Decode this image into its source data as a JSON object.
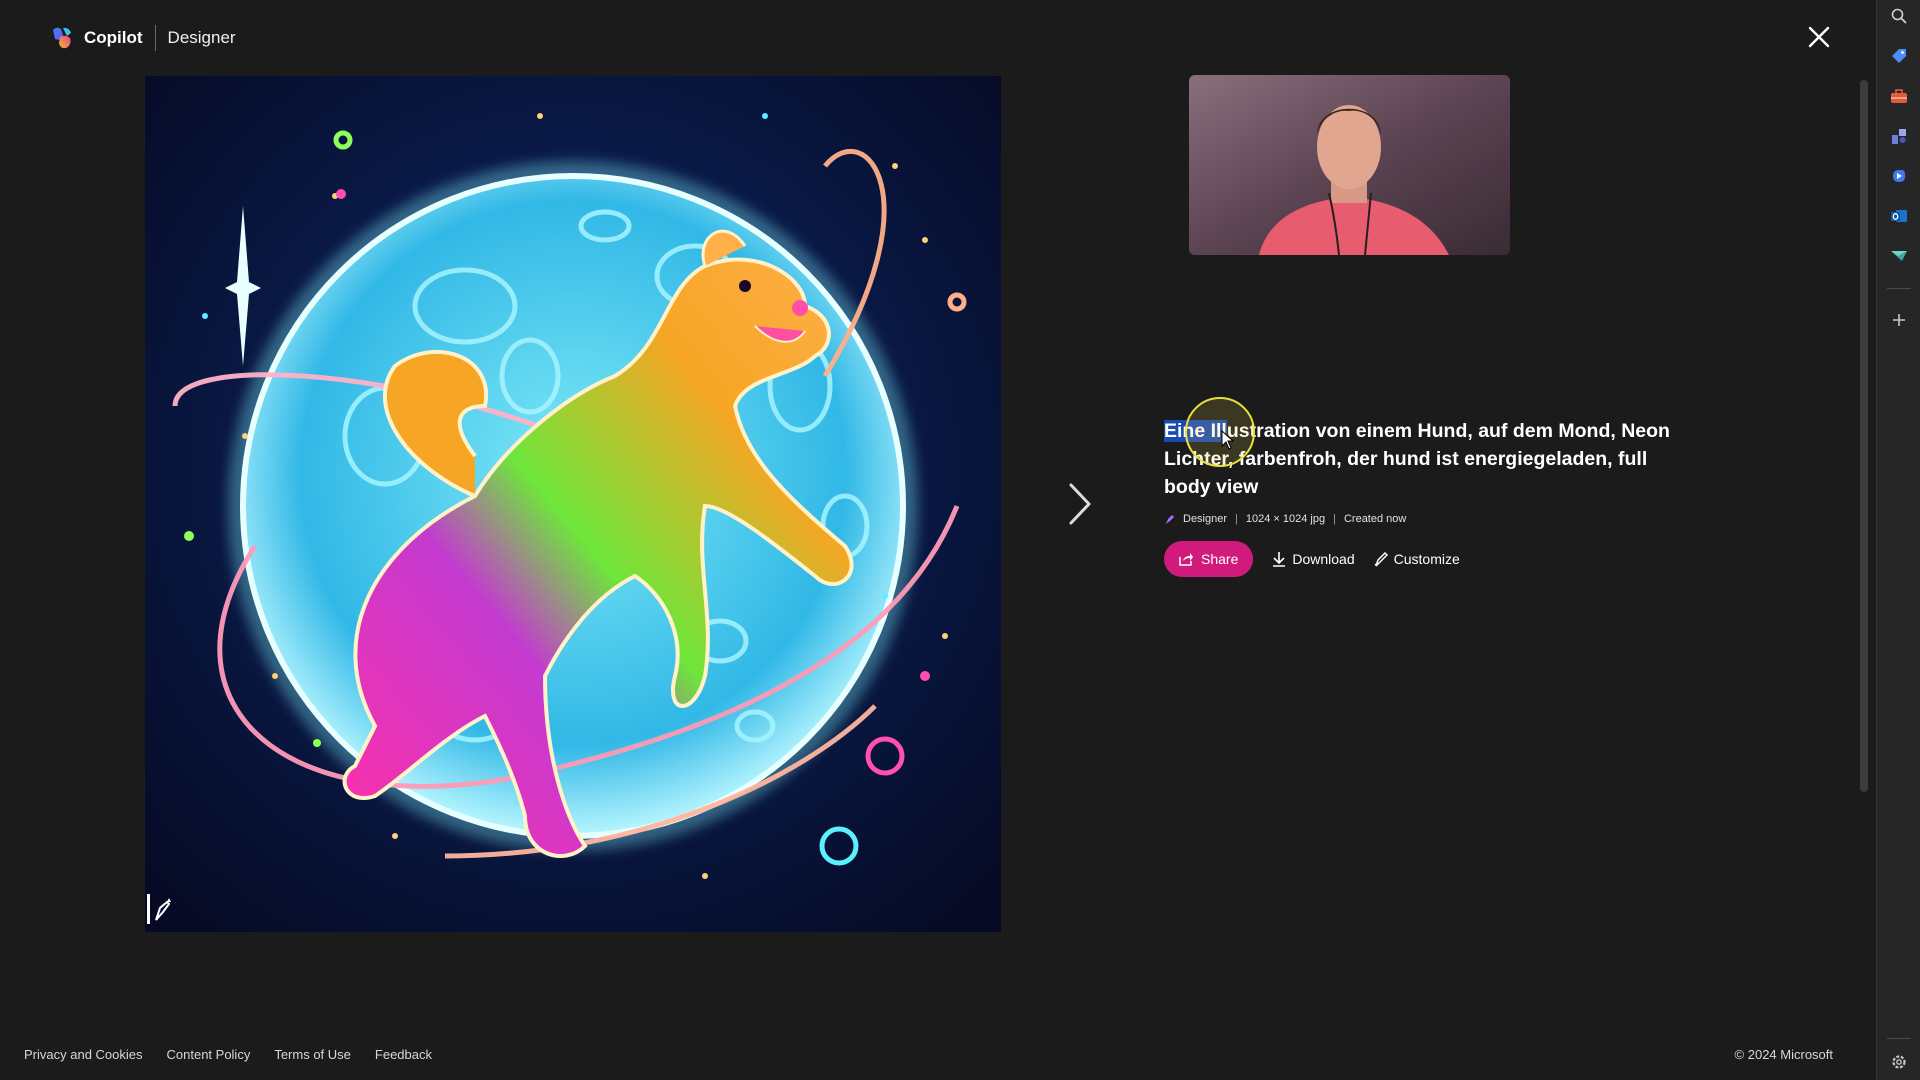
{
  "header": {
    "brand": "Copilot",
    "product": "Designer",
    "logo_icon": "copilot-logo-icon",
    "close_icon": "close-icon"
  },
  "image": {
    "alt": "Eine Illustration von einem Hund, auf dem Mond, Neon Lichter, farbenfroh, der hund ist energiegeladen, full body view",
    "watermark_icon": "designer-watermark-icon"
  },
  "navigation": {
    "next_icon": "chevron-right-icon"
  },
  "details": {
    "prompt_selected": "Eine Ill",
    "prompt_rest": "ustration von einem Hund, auf dem Mond, Neon Lichter, farbenfroh, der hund ist energiegeladen, full body view",
    "meta": {
      "source": "Designer",
      "dimensions": "1024 × 1024 jpg",
      "created": "Created now"
    },
    "actions": {
      "share": "Share",
      "download": "Download",
      "customize": "Customize"
    }
  },
  "footer": {
    "links": [
      "Privacy and Cookies",
      "Content Policy",
      "Terms of Use",
      "Feedback"
    ],
    "copyright": "© 2024 Microsoft"
  },
  "sidebar": {
    "icons": [
      "search-icon",
      "tag-icon",
      "toolbox-icon",
      "games-icon",
      "copilot-icon",
      "outlook-icon",
      "send-icon",
      "add-icon",
      "settings-icon"
    ]
  },
  "colors": {
    "background": "#1c1b1b",
    "share_button": "#d01b7d",
    "selection": "#1b49b4",
    "sidebar": "#262626"
  }
}
